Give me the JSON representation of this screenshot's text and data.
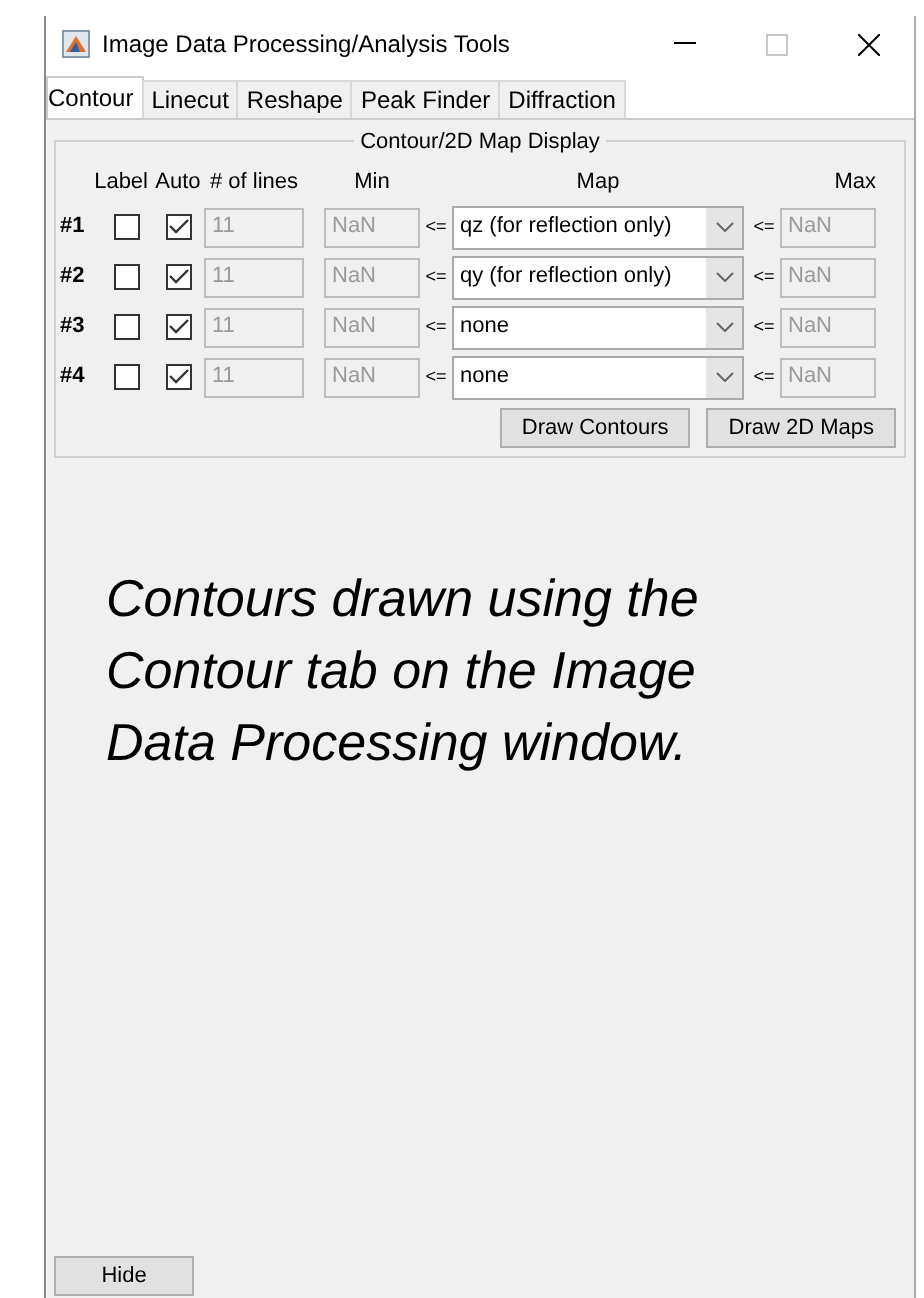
{
  "window": {
    "title": "Image Data Processing/Analysis Tools"
  },
  "tabs": [
    {
      "label": "Contour",
      "selected": true
    },
    {
      "label": "Linecut",
      "selected": false
    },
    {
      "label": "Reshape",
      "selected": false
    },
    {
      "label": "Peak Finder",
      "selected": false
    },
    {
      "label": "Diffraction",
      "selected": false
    }
  ],
  "panel": {
    "title": "Contour/2D Map Display",
    "columns": [
      "Label",
      "Auto",
      "# of lines",
      "Min",
      "Map",
      "Max"
    ],
    "rows": [
      {
        "number": "#1",
        "label_checked": false,
        "auto_checked": true,
        "lines": "11",
        "min": "NaN",
        "le_min": "<=",
        "map": "qz (for reflection only)",
        "le_max": "<=",
        "max": "NaN",
        "disabled": true
      },
      {
        "number": "#2",
        "label_checked": false,
        "auto_checked": true,
        "lines": "11",
        "min": "NaN",
        "le_min": "<=",
        "map": "qy (for reflection only)",
        "le_max": "<=",
        "max": "NaN",
        "disabled": true
      },
      {
        "number": "#3",
        "label_checked": false,
        "auto_checked": true,
        "lines": "11",
        "min": "NaN",
        "le_min": "<=",
        "map": "none",
        "le_max": "<=",
        "max": "NaN",
        "disabled": true
      },
      {
        "number": "#4",
        "label_checked": false,
        "auto_checked": true,
        "lines": "11",
        "min": "NaN",
        "le_min": "<=",
        "map": "none",
        "le_max": "<=",
        "max": "NaN",
        "disabled": true
      }
    ],
    "buttons": [
      "Draw Contours",
      "Draw 2D Maps"
    ]
  },
  "caption": "Contours drawn using the Contour tab on the Image Data Processing window.",
  "hide_button": "Hide"
}
